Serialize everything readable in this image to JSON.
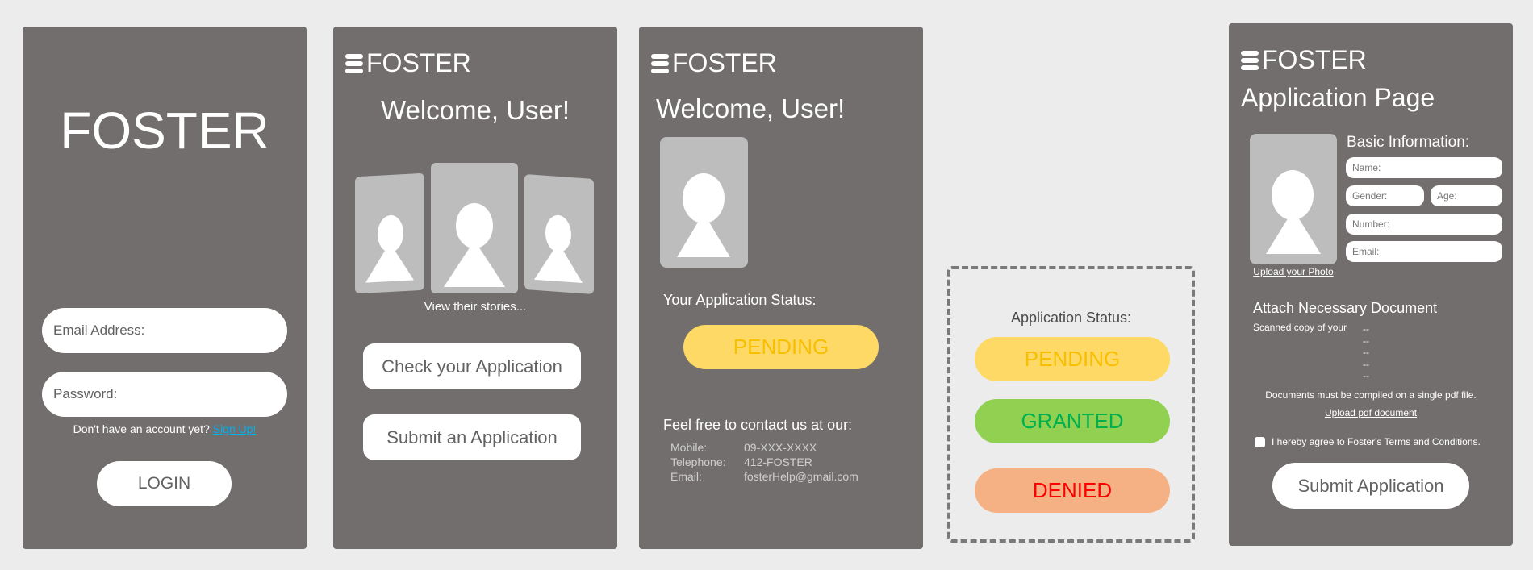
{
  "login": {
    "logo": "FOSTER",
    "email_placeholder": "Email Address:",
    "password_placeholder": "Password:",
    "signup_prompt": "Don't have an account yet?",
    "signup_link": "Sign Up!",
    "login_button": "LOGIN"
  },
  "home": {
    "brand": "FOSTER",
    "welcome": "Welcome, User!",
    "stories_caption": "View their stories...",
    "check_button": "Check your Application",
    "submit_button": "Submit an Application"
  },
  "status_screen": {
    "brand": "FOSTER",
    "welcome": "Welcome, User!",
    "status_label": "Your Application Status:",
    "status_value": "PENDING",
    "contact_heading": "Feel free to contact us at our:",
    "contacts": [
      {
        "label": "Mobile:",
        "value": "09-XXX-XXXX"
      },
      {
        "label": "Telephone:",
        "value": "412-FOSTER"
      },
      {
        "label": "Email:",
        "value": "fosterHelp@gmail.com"
      }
    ]
  },
  "status_legend": {
    "title": "Application Status:",
    "pending": "PENDING",
    "granted": "GRANTED",
    "denied": "DENIED"
  },
  "application": {
    "brand": "FOSTER",
    "title": "Application Page",
    "basic_info": "Basic Information:",
    "name_placeholder": "Name:",
    "gender_placeholder": "Gender:",
    "age_placeholder": "Age:",
    "number_placeholder": "Number:",
    "email_placeholder": "Email:",
    "upload_photo": "Upload your Photo",
    "attach_heading": "Attach Necessary Document",
    "scanned_label": "Scanned copy of your",
    "doc_items": [
      "--",
      "--",
      "--",
      "--",
      "--"
    ],
    "pdf_note": "Documents must be compiled on a single pdf file.",
    "upload_pdf": "Upload pdf document",
    "terms": "I hereby agree to Foster's Terms and Conditions.",
    "submit_button": "Submit Application"
  },
  "colors": {
    "panel": "#726e6d",
    "background": "#ececec",
    "pending_bg": "#fed966",
    "pending_text": "#f8bf00",
    "granted_bg": "#91d051",
    "granted_text": "#00b050",
    "denied_bg": "#f5b183",
    "denied_text": "#ff0000",
    "link": "#00b0f0"
  }
}
